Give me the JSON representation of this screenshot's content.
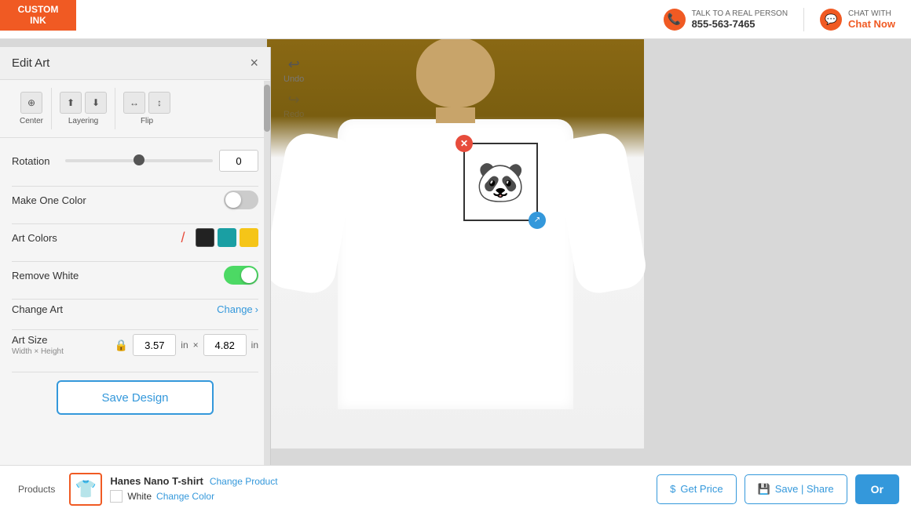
{
  "header": {
    "logo_line1": "CUSTOM",
    "logo_line2": "INK",
    "contact_label": "TALK TO A REAL PERSON",
    "contact_number": "855-563-7465",
    "chat_label": "CHAT WITH",
    "chat_action": "Chat Now"
  },
  "panel": {
    "title": "Edit Art",
    "close_icon": "×",
    "toolbar": {
      "center_label": "Center",
      "layering_label": "Layering",
      "flip_label": "Flip"
    },
    "undo_label": "Undo",
    "redo_label": "Redo",
    "rotation_label": "Rotation",
    "rotation_value": "0",
    "make_one_color_label": "Make One Color",
    "art_colors_label": "Art Colors",
    "remove_white_label": "Remove White",
    "change_art_label": "Change Art",
    "change_art_link": "Change",
    "art_size_label": "Art Size",
    "art_size_sub": "Width × Height",
    "width_value": "3.57",
    "height_value": "4.82",
    "unit": "in",
    "save_design_label": "Save Design"
  },
  "colors": {
    "swatches": [
      {
        "name": "slash",
        "color": null
      },
      {
        "name": "black",
        "color": "#222222"
      },
      {
        "name": "teal",
        "color": "#1a9fa3"
      },
      {
        "name": "yellow",
        "color": "#f5c518"
      }
    ]
  },
  "bottom": {
    "products_label": "Products",
    "shirt_name": "Hanes Nano T-shirt",
    "change_product_label": "Change Product",
    "color_name": "White",
    "change_color_label": "Change Color",
    "get_price_label": "Get Price",
    "save_share_label": "Save | Share",
    "order_label": "Or"
  }
}
